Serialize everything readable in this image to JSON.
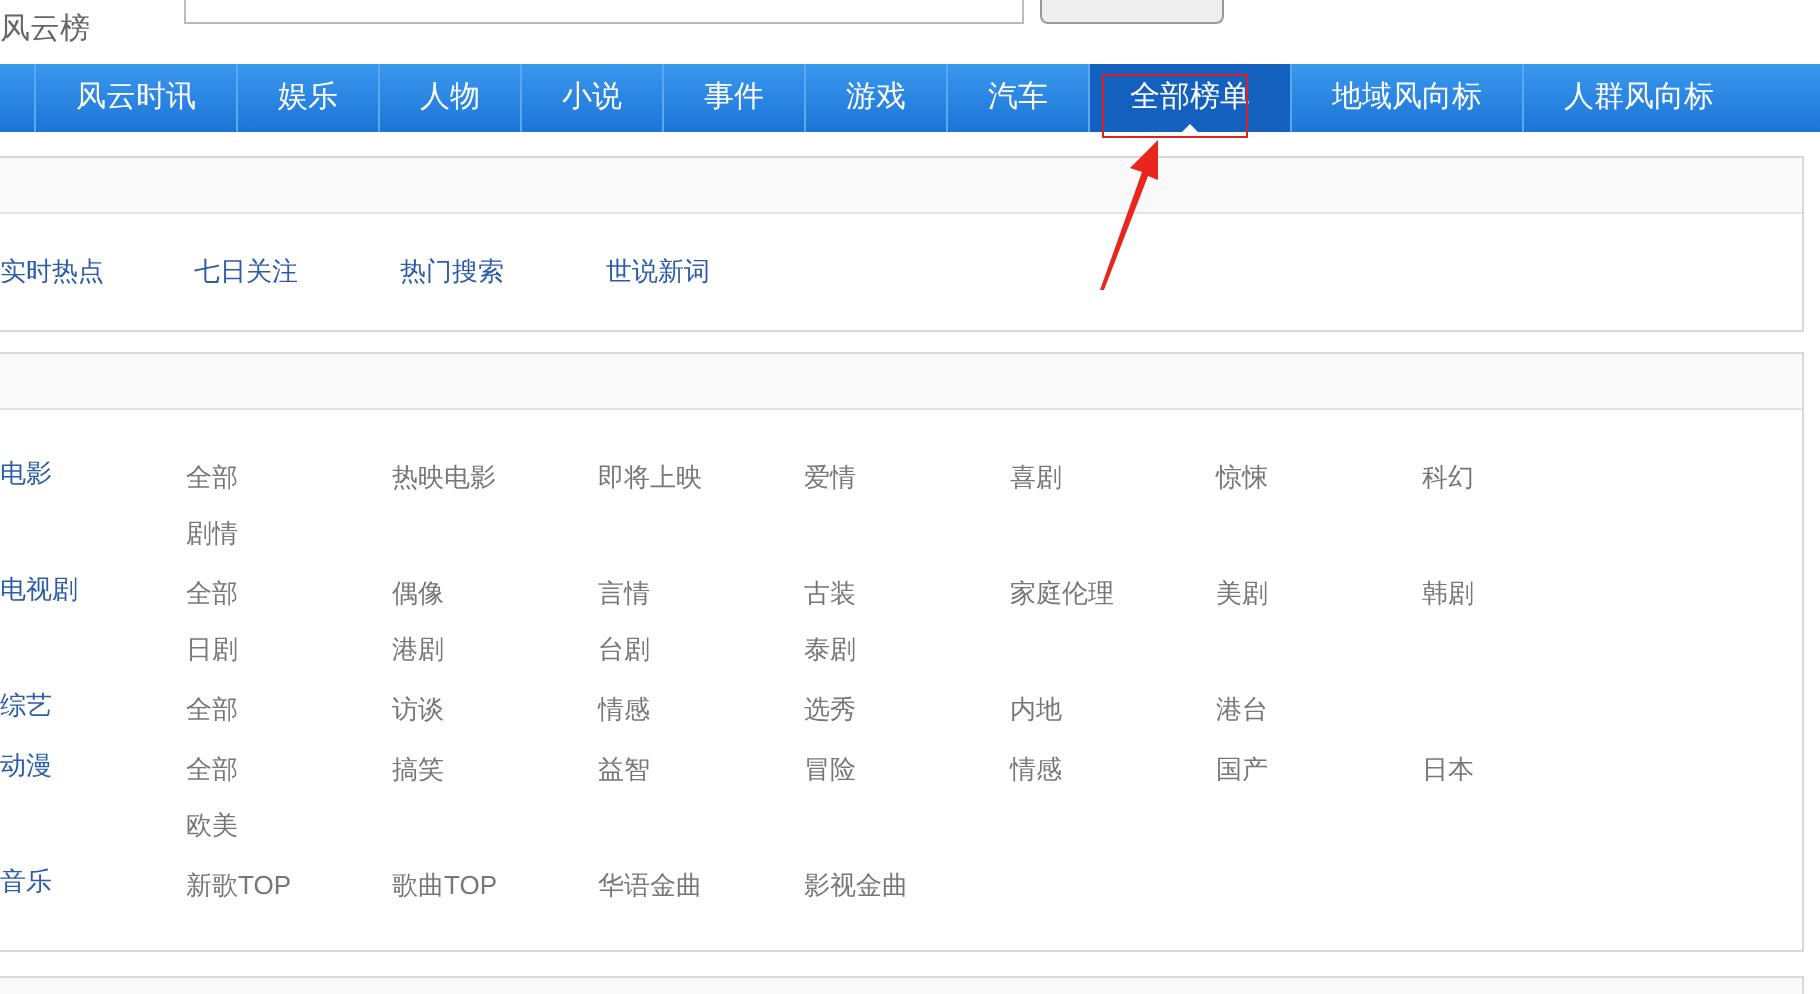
{
  "logo": {
    "text": "风云榜"
  },
  "nav": [
    {
      "label": "风云时讯",
      "selected": false
    },
    {
      "label": "娱乐",
      "selected": false
    },
    {
      "label": "人物",
      "selected": false
    },
    {
      "label": "小说",
      "selected": false
    },
    {
      "label": "事件",
      "selected": false
    },
    {
      "label": "游戏",
      "selected": false
    },
    {
      "label": "汽车",
      "selected": false
    },
    {
      "label": "全部榜单",
      "selected": true
    },
    {
      "label": "地域风向标",
      "selected": false
    },
    {
      "label": "人群风向标",
      "selected": false
    }
  ],
  "sections": [
    {
      "rows": [
        {
          "items": [
            "实时热点",
            "七日关注",
            "热门搜索",
            "世说新词"
          ],
          "kind": "links"
        }
      ]
    },
    {
      "rows": [
        {
          "kind": "category",
          "label": "电影",
          "items": [
            "全部",
            "热映电影",
            "即将上映",
            "爱情",
            "喜剧",
            "惊悚",
            "科幻",
            "剧情"
          ]
        },
        {
          "kind": "category",
          "label": "电视剧",
          "items": [
            "全部",
            "偶像",
            "言情",
            "古装",
            "家庭伦理",
            "美剧",
            "韩剧",
            "日剧",
            "港剧",
            "台剧",
            "泰剧"
          ]
        },
        {
          "kind": "category",
          "label": "综艺",
          "items": [
            "全部",
            "访谈",
            "情感",
            "选秀",
            "内地",
            "港台"
          ]
        },
        {
          "kind": "category",
          "label": "动漫",
          "items": [
            "全部",
            "搞笑",
            "益智",
            "冒险",
            "情感",
            "国产",
            "日本",
            "欧美"
          ]
        },
        {
          "kind": "category",
          "label": "音乐",
          "items": [
            "新歌TOP",
            "歌曲TOP",
            "华语金曲",
            "影视金曲"
          ]
        }
      ]
    }
  ]
}
